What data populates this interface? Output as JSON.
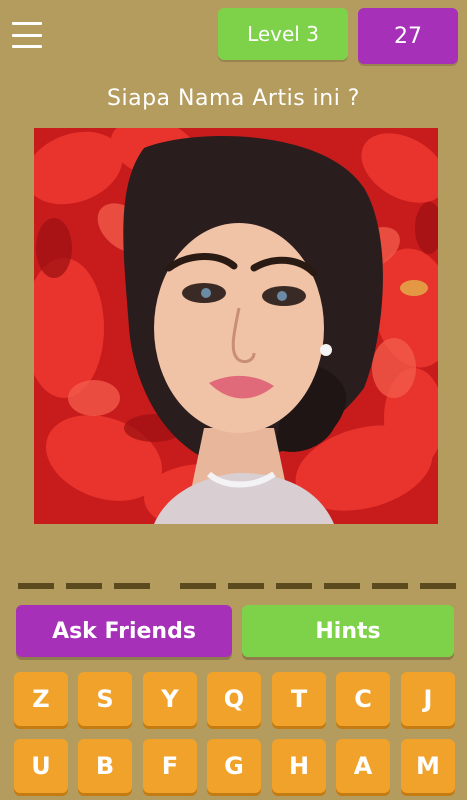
{
  "header": {
    "level_label": "Level 3",
    "coins": "27"
  },
  "question": "Siapa Nama Artis ini ?",
  "answer_slots": {
    "word_lengths": [
      3,
      6
    ]
  },
  "buttons": {
    "ask_friends": "Ask Friends",
    "hints": "Hints"
  },
  "keys": [
    [
      "Z",
      "S",
      "Y",
      "Q",
      "T",
      "C",
      "J"
    ],
    [
      "U",
      "B",
      "F",
      "G",
      "H",
      "A",
      "M"
    ]
  ],
  "colors": {
    "background": "#b49c5e",
    "green": "#7ed24a",
    "purple": "#a630b8",
    "key_orange": "#f0a22b"
  }
}
